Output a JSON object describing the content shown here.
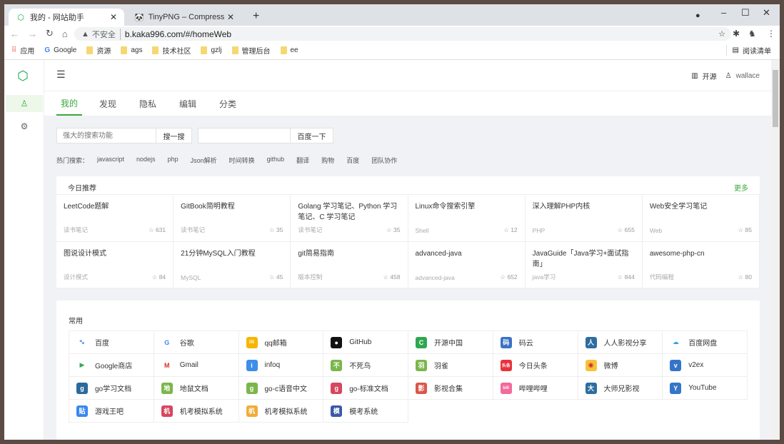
{
  "browser": {
    "tabs": [
      {
        "title": "我的 - 网站助手",
        "close": "✕"
      },
      {
        "title": "TinyPNG – Compress PNG ima",
        "close": "✕"
      }
    ],
    "new_tab": "+",
    "security": "不安全",
    "url": "b.kaka996.com/#/homeWeb",
    "bookmarks": [
      {
        "label": "应用"
      },
      {
        "label": "Google"
      },
      {
        "label": "资源"
      },
      {
        "label": "ags"
      },
      {
        "label": "技术社区"
      },
      {
        "label": "gzlj"
      },
      {
        "label": "管理后台"
      },
      {
        "label": "ee"
      }
    ],
    "reading_list": "阅读清单"
  },
  "header": {
    "open_source": "开源",
    "user": "wallace"
  },
  "nav_tabs": [
    "我的",
    "发现",
    "隐私",
    "编辑",
    "分类"
  ],
  "search": {
    "placeholder": "强大的搜索功能",
    "button": "搜一搜",
    "baidu_value": "",
    "baidu_button": "百度一下"
  },
  "hot": {
    "label": "热门搜索：",
    "items": [
      "javascript",
      "nodejs",
      "php",
      "Json解析",
      "时间转换",
      "github",
      "翻译",
      "购物",
      "百度",
      "团队协作"
    ]
  },
  "recommend": {
    "title": "今日推荐",
    "more": "更多",
    "items": [
      {
        "title": "LeetCode题解",
        "cat": "读书笔记",
        "stars": "631"
      },
      {
        "title": "GitBook简明教程",
        "cat": "读书笔记",
        "stars": "35"
      },
      {
        "title": "Golang 学习笔记、Python 学习笔记、C 学习笔记",
        "cat": "读书笔记",
        "stars": "35"
      },
      {
        "title": "Linux命令搜索引擎",
        "cat": "Shell",
        "stars": "12"
      },
      {
        "title": "深入理解PHP内核",
        "cat": "PHP",
        "stars": "655"
      },
      {
        "title": "Web安全学习笔记",
        "cat": "Web",
        "stars": "85"
      },
      {
        "title": "图说设计模式",
        "cat": "设计模式",
        "stars": "84"
      },
      {
        "title": "21分钟MySQL入门教程",
        "cat": "MySQL",
        "stars": "45"
      },
      {
        "title": "git简易指南",
        "cat": "版本控制",
        "stars": "458"
      },
      {
        "title": "advanced-java",
        "cat": "advanced-java",
        "stars": "652"
      },
      {
        "title": "JavaGuide「Java学习+面试指南」",
        "cat": "java学习",
        "stars": "844"
      },
      {
        "title": "awesome-php-cn",
        "cat": "代码编程",
        "stars": "80"
      }
    ]
  },
  "common": {
    "title": "常用",
    "items": [
      {
        "label": "百度",
        "icon": "🐾",
        "color": "#ffffff",
        "fg": "#3b6fe0"
      },
      {
        "label": "谷歌",
        "icon": "G",
        "color": "#ffffff",
        "fg": "#4285f4"
      },
      {
        "label": "qq邮箱",
        "icon": "✉",
        "color": "#f7b500",
        "fg": "#fff"
      },
      {
        "label": "GitHub",
        "icon": "●",
        "color": "#111111",
        "fg": "#fff"
      },
      {
        "label": "开源中国",
        "icon": "C",
        "color": "#2fa84f",
        "fg": "#fff"
      },
      {
        "label": "码云",
        "icon": "码",
        "color": "#3b73c4",
        "fg": "#fff"
      },
      {
        "label": "人人影视分享",
        "icon": "人",
        "color": "#2d6ea0",
        "fg": "#fff"
      },
      {
        "label": "百度网盘",
        "icon": "☁",
        "color": "#ffffff",
        "fg": "#3aa0e8"
      },
      {
        "label": "Google商店",
        "icon": "▶",
        "color": "#ffffff",
        "fg": "#34a853"
      },
      {
        "label": "Gmail",
        "icon": "M",
        "color": "#ffffff",
        "fg": "#d93025"
      },
      {
        "label": "infoq",
        "icon": "i",
        "color": "#3d8ee6",
        "fg": "#fff"
      },
      {
        "label": "不死鸟",
        "icon": "不",
        "color": "#7bb64a",
        "fg": "#fff"
      },
      {
        "label": "羽雀",
        "icon": "羽",
        "color": "#7bb64a",
        "fg": "#fff"
      },
      {
        "label": "今日头条",
        "icon": "头条",
        "color": "#e8323c",
        "fg": "#fff"
      },
      {
        "label": "微博",
        "icon": "◉",
        "color": "#f5c33b",
        "fg": "#d6262d"
      },
      {
        "label": "v2ex",
        "icon": "v",
        "color": "#3575c9",
        "fg": "#fff"
      },
      {
        "label": "go学习文档",
        "icon": "g",
        "color": "#2b6a9c",
        "fg": "#fff"
      },
      {
        "label": "地鼠文档",
        "icon": "地",
        "color": "#7bb64a",
        "fg": "#fff"
      },
      {
        "label": "go-c语音中文",
        "icon": "g",
        "color": "#7bb64a",
        "fg": "#fff"
      },
      {
        "label": "go-标准文档",
        "icon": "g",
        "color": "#d8455f",
        "fg": "#fff"
      },
      {
        "label": "影视合集",
        "icon": "影",
        "color": "#d9574a",
        "fg": "#fff"
      },
      {
        "label": "哔哩哔哩",
        "icon": "bili",
        "color": "#f36a9b",
        "fg": "#fff"
      },
      {
        "label": "大师兄影视",
        "icon": "大",
        "color": "#2d6ea0",
        "fg": "#fff"
      },
      {
        "label": "YouTube",
        "icon": "Y",
        "color": "#3575c9",
        "fg": "#fff"
      },
      {
        "label": "游戏王吧",
        "icon": "贴",
        "color": "#3a88f0",
        "fg": "#fff"
      },
      {
        "label": "机考模拟系统",
        "icon": "机",
        "color": "#d8455f",
        "fg": "#fff"
      },
      {
        "label": "机考模拟系统",
        "icon": "机",
        "color": "#f0ac3a",
        "fg": "#fff"
      },
      {
        "label": "模考系统",
        "icon": "模",
        "color": "#3b58a8",
        "fg": "#fff"
      }
    ]
  },
  "colors": {
    "accent": "#3aa83a",
    "page_bg": "#f0f2f5"
  }
}
